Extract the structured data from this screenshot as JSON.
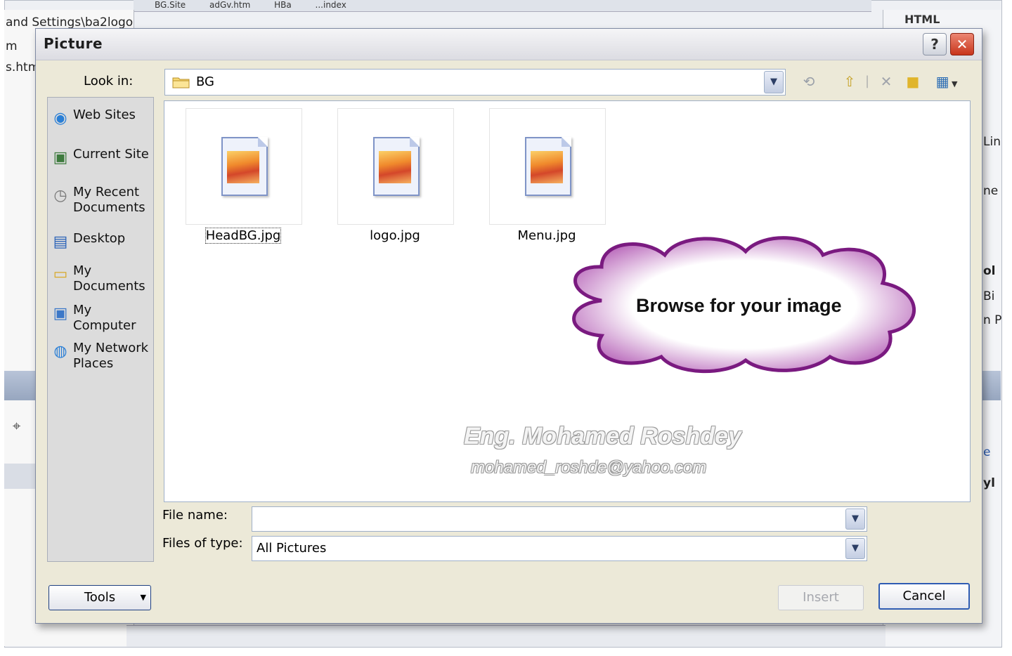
{
  "background": {
    "left_paths": [
      "and Settings\\ba2logo",
      "m",
      "s.htm"
    ],
    "top_tabs": [
      "BG.Site",
      "adGv.htm",
      "HBa",
      "...index"
    ],
    "right_header": "HTML",
    "right_fragments": [
      "Lin",
      "ne",
      "ol",
      "Bi",
      "n P",
      "e",
      "yl"
    ]
  },
  "dialog": {
    "title": "Picture",
    "help_label": "?",
    "close_label": "✕",
    "look_in": {
      "label": "Look in:",
      "value": "BG"
    },
    "toolbar": [
      "back-icon",
      "up-folder-icon",
      "delete-icon",
      "new-folder-icon",
      "views-icon"
    ],
    "places": [
      {
        "label": "Web Sites",
        "icon": "globe-icon"
      },
      {
        "label": "Current Site",
        "icon": "current-site-icon"
      },
      {
        "label": "My Recent Documents",
        "icon": "recent-documents-icon"
      },
      {
        "label": "Desktop",
        "icon": "desktop-icon"
      },
      {
        "label": "My Documents",
        "icon": "my-documents-icon"
      },
      {
        "label": "My Computer",
        "icon": "my-computer-icon"
      },
      {
        "label": "My Network Places",
        "icon": "network-places-icon"
      }
    ],
    "files": [
      {
        "name": "HeadBG.jpg",
        "selected": true
      },
      {
        "name": "logo.jpg",
        "selected": false
      },
      {
        "name": "Menu.jpg",
        "selected": false
      }
    ],
    "callout": "Browse for your image",
    "watermark": {
      "name": "Eng. Mohamed Roshdey",
      "email": "mohamed_roshde@yahoo.com"
    },
    "file_name": {
      "label": "File name:",
      "value": ""
    },
    "files_of_type": {
      "label": "Files of type:",
      "value": "All Pictures"
    },
    "buttons": {
      "tools": "Tools",
      "insert": "Insert",
      "cancel": "Cancel"
    }
  }
}
